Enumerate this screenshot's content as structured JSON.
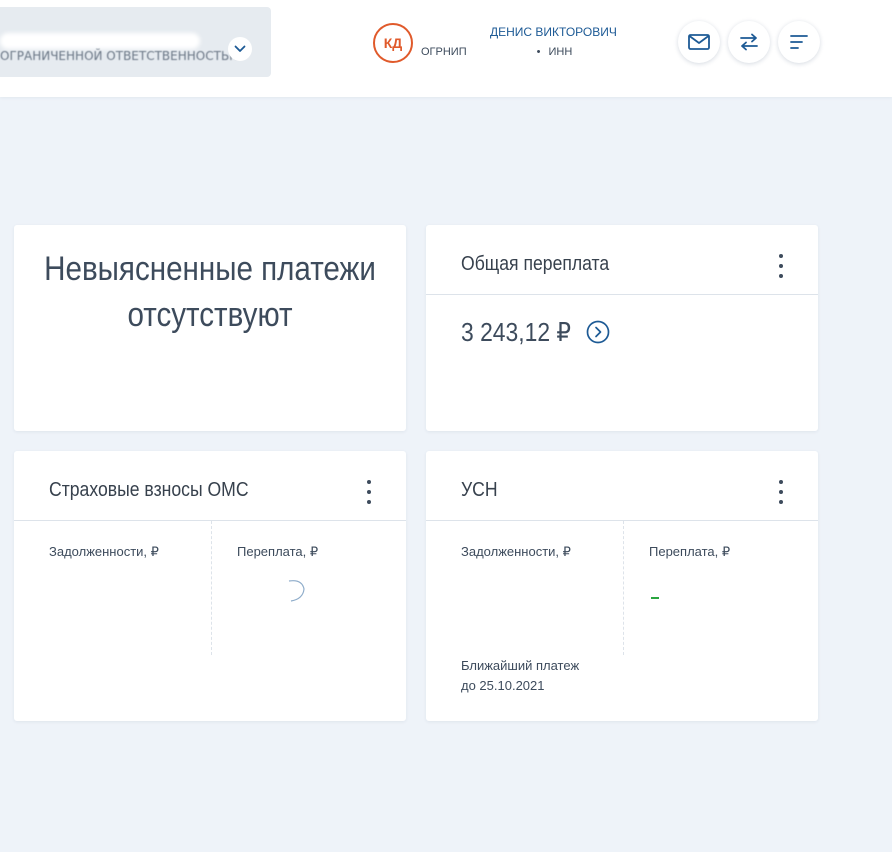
{
  "header": {
    "org_name": "ОГРАНИЧЕННОЙ ОТВЕТСТВЕННОСТЬЮ",
    "user_initials": "КД",
    "user_name": "ДЕНИС ВИКТОРОВИЧ",
    "ogrnip_label": "ОГРНИП",
    "inn_label": "ИНН",
    "icons": [
      "chevron-down",
      "mail",
      "swap-arrows",
      "menu"
    ]
  },
  "cards": {
    "unresolved": {
      "line1": "Невыясненные платежи",
      "line2": "отсутствуют"
    },
    "overpayment": {
      "title": "Общая переплата",
      "amount": "3 243,12 ₽"
    },
    "oms": {
      "title": "Страховые взносы ОМС",
      "debt_label": "Задолженности, ₽",
      "overpay_label": "Переплата, ₽"
    },
    "usn": {
      "title": "УСН",
      "debt_label": "Задолженности, ₽",
      "overpay_label": "Переплата, ₽",
      "next_payment_label": "Ближайший платеж",
      "next_payment_date": "до 25.10.2021"
    }
  },
  "colors": {
    "accent_orange": "#e05a2b",
    "accent_blue": "#1d5a95",
    "background": "#eef3f9",
    "text": "#3d4b5c"
  }
}
